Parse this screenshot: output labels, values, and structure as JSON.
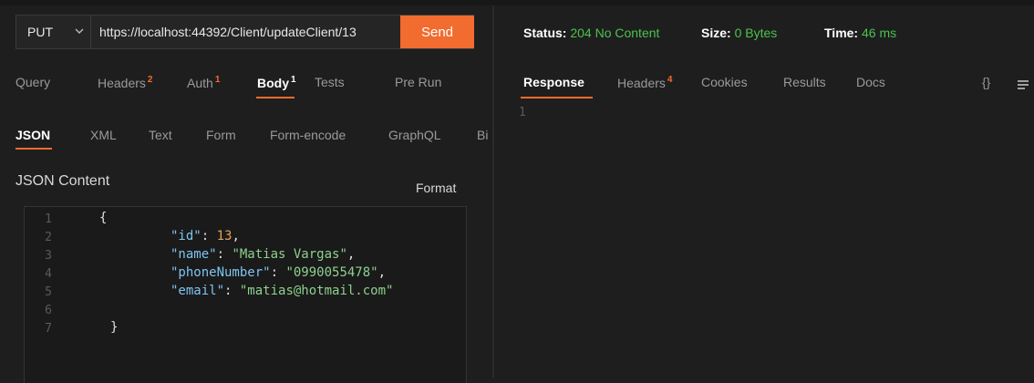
{
  "request": {
    "method": "PUT",
    "url": "https://localhost:44392/Client/updateClient/13",
    "send_label": "Send"
  },
  "request_tabs": [
    {
      "label": "Query",
      "badge": ""
    },
    {
      "label": "Headers",
      "badge": "2"
    },
    {
      "label": "Auth",
      "badge": "1"
    },
    {
      "label": "Body",
      "badge": "1"
    },
    {
      "label": "Tests",
      "badge": ""
    },
    {
      "label": "Pre Run",
      "badge": ""
    }
  ],
  "body_tabs": [
    "JSON",
    "XML",
    "Text",
    "Form",
    "Form-encode",
    "GraphQL",
    "Bi"
  ],
  "body": {
    "section_title": "JSON Content",
    "format_label": "Format",
    "line_numbers": [
      "1",
      "2",
      "3",
      "4",
      "5",
      "6",
      "7"
    ],
    "code": {
      "open_brace": "{",
      "close_brace": "}",
      "fields": [
        {
          "key": "\"id\"",
          "sep": ": ",
          "value": "13",
          "type": "number",
          "trail": ","
        },
        {
          "key": "\"name\"",
          "sep": ": ",
          "value": "\"Matias Vargas\"",
          "type": "string",
          "trail": ","
        },
        {
          "key": "\"phoneNumber\"",
          "sep": ": ",
          "value": "\"0990055478\"",
          "type": "string",
          "trail": ","
        },
        {
          "key": "\"email\"",
          "sep": ": ",
          "value": "\"matias@hotmail.com\"",
          "type": "string",
          "trail": ""
        }
      ]
    }
  },
  "response": {
    "status_label": "Status:",
    "status_value": "204 No Content",
    "size_label": "Size:",
    "size_value": "0 Bytes",
    "time_label": "Time:",
    "time_value": "46 ms",
    "tabs": [
      {
        "label": "Response",
        "badge": ""
      },
      {
        "label": "Headers",
        "badge": "4"
      },
      {
        "label": "Cookies",
        "badge": ""
      },
      {
        "label": "Results",
        "badge": ""
      },
      {
        "label": "Docs",
        "badge": ""
      }
    ],
    "braces_icon": "{}",
    "line_number": "1"
  },
  "colors": {
    "accent": "#f26c2f",
    "status_green": "#4cc24c",
    "background": "#1e1e1e"
  }
}
